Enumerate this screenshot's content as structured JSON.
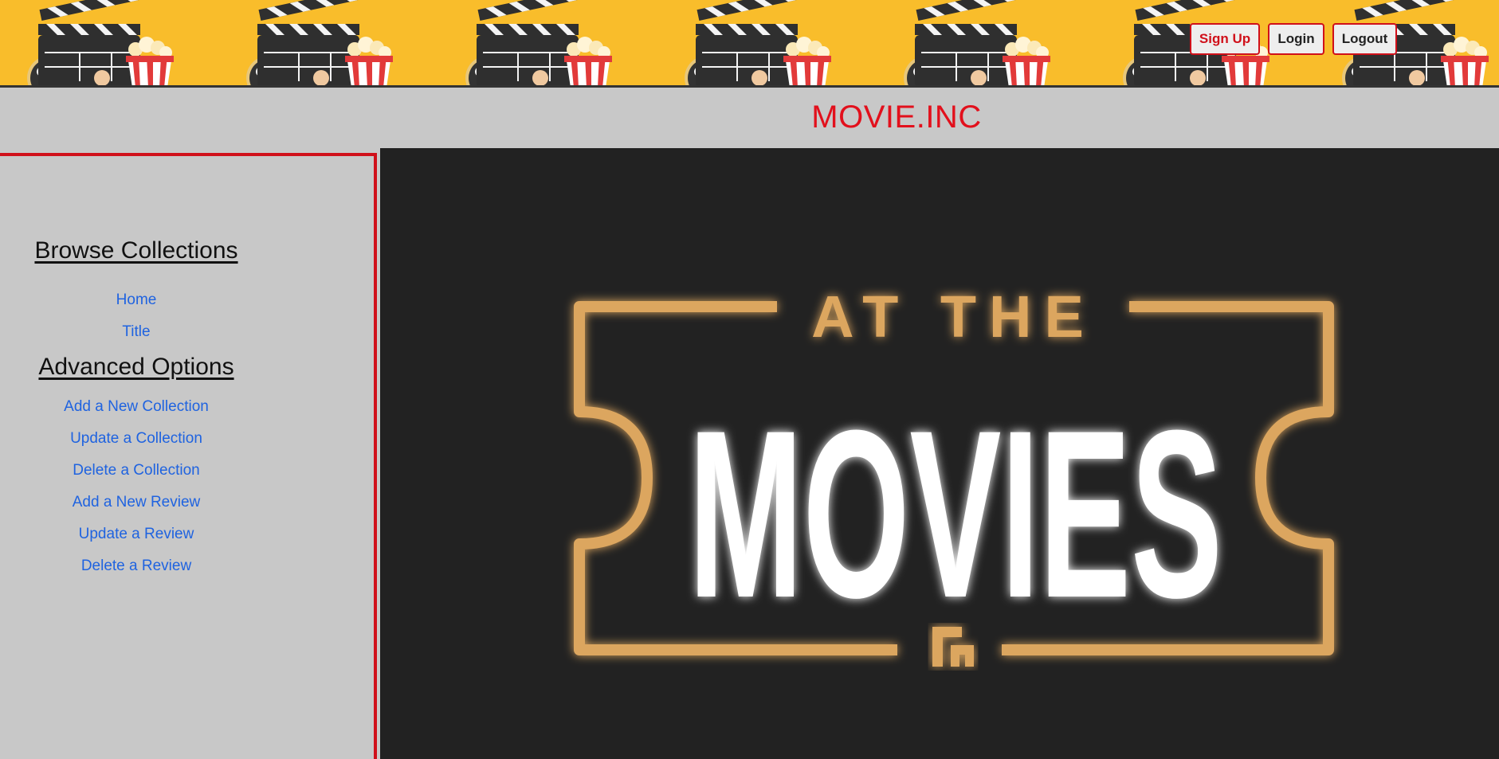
{
  "header": {
    "auth_buttons": {
      "signup": "Sign Up",
      "login": "Login",
      "logout": "Logout"
    },
    "banner_icons": [
      "clapperboard-icon",
      "film-reel-icon",
      "popcorn-icon"
    ]
  },
  "brand": {
    "title": "MOVIE.INC"
  },
  "sidebar": {
    "browse_heading": "Browse Collections",
    "browse_links": [
      "Home",
      "Title"
    ],
    "advanced_heading": "Advanced Options",
    "advanced_links": [
      "Add a New Collection",
      "Update a Collection",
      "Delete a Collection",
      "Add a New Review",
      "Update a Review",
      "Delete a Review"
    ]
  },
  "hero": {
    "line1": "AT THE",
    "line2": "MOVIES"
  },
  "colors": {
    "banner": "#f9bd2b",
    "accent_red": "#d0101a",
    "link_blue": "#1f63e0",
    "hero_bg": "#222222",
    "hero_gold": "#dca65f"
  }
}
